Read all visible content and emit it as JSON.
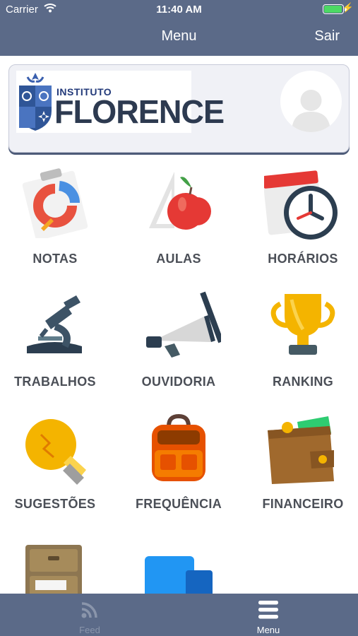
{
  "status_bar": {
    "carrier": "Carrier",
    "time": "11:40 AM",
    "battery_level": 1.0
  },
  "nav": {
    "title": "Menu",
    "logout_label": "Sair"
  },
  "header": {
    "logo_small_text": "INSTITUTO",
    "logo_big_text": "FLORENCE",
    "avatar_icon": "user-silhouette-icon"
  },
  "menu": {
    "items": [
      {
        "label": "NOTAS",
        "icon": "grades-clipboard-icon"
      },
      {
        "label": "AULAS",
        "icon": "apple-ruler-icon"
      },
      {
        "label": "HORÁRIOS",
        "icon": "calendar-clock-icon"
      },
      {
        "label": "TRABALHOS",
        "icon": "microscope-icon"
      },
      {
        "label": "OUVIDORIA",
        "icon": "megaphone-icon"
      },
      {
        "label": "RANKING",
        "icon": "trophy-icon"
      },
      {
        "label": "SUGESTÕES",
        "icon": "lightbulb-icon"
      },
      {
        "label": "FREQUÊNCIA",
        "icon": "backpack-icon"
      },
      {
        "label": "FINANCEIRO",
        "icon": "wallet-icon"
      },
      {
        "label": "",
        "icon": "file-cabinet-icon"
      },
      {
        "label": "",
        "icon": "blue-folder-icon"
      }
    ]
  },
  "tabbar": {
    "tabs": [
      {
        "label": "Feed",
        "icon": "rss-feed-icon",
        "active": false
      },
      {
        "label": "Menu",
        "icon": "hamburger-menu-icon",
        "active": true
      }
    ]
  },
  "colors": {
    "bar_background": "#5b6a88",
    "label_text": "#4b4f57",
    "tab_inactive": "#8a95ab",
    "tab_active": "#ffffff"
  }
}
